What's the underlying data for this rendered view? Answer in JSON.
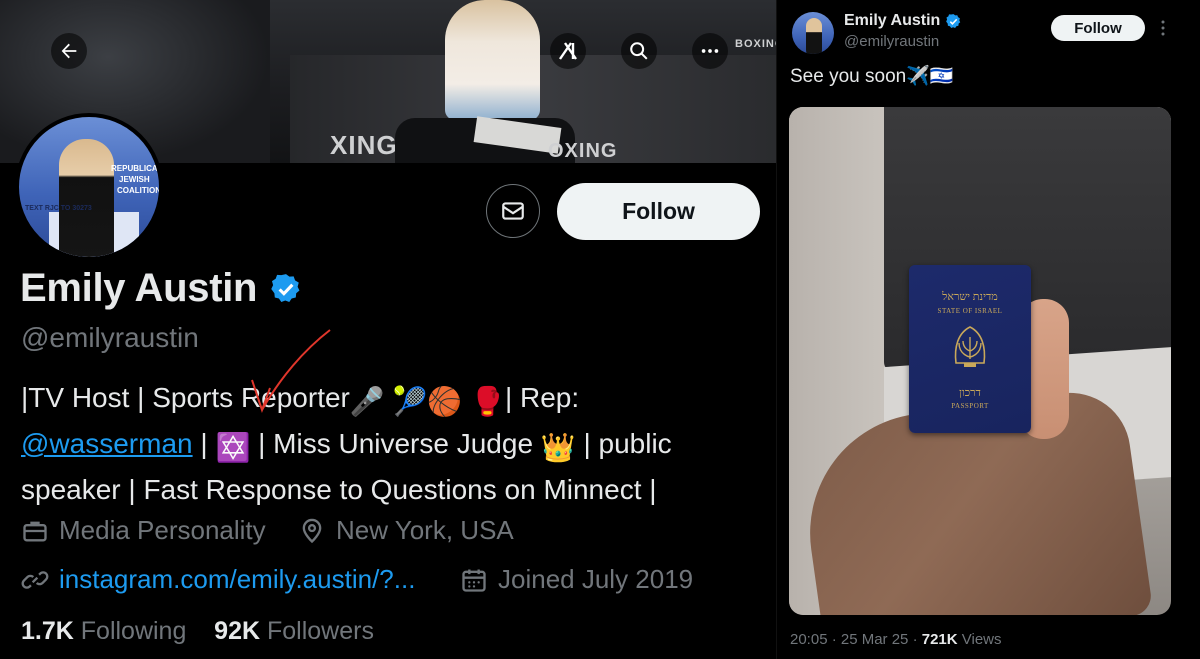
{
  "profile": {
    "banner": {
      "logo_texts": [
        "BOXING",
        "XING",
        "OXING"
      ],
      "back_icon": "arrow-left-icon",
      "grok_icon": "grok-icon",
      "search_icon": "search-icon",
      "more_icon": "more-horizontal-icon"
    },
    "avatar_texts": [
      "REPUBLICAN",
      "JEWISH",
      "COALITION",
      "TEXT RJC TO 30273"
    ],
    "follow_label": "Follow",
    "name": "Emily Austin",
    "handle": "@emilyraustin",
    "bio": {
      "line1_a": "|TV Host | Sports Reporter",
      "line1_b": "| Rep:",
      "mention": "@wasserman",
      "sep1": " | ",
      "line2_b": " | Miss Universe Judge ",
      "line2_c": " | public",
      "line3": "speaker | Fast Response to Questions on Minnect |",
      "emojis": [
        "🎤",
        "🎾",
        "🏀",
        "🥊",
        "✡️",
        "👑"
      ]
    },
    "category": "Media Personality",
    "location": "New York, USA",
    "website": "instagram.com/emily.austin/?...",
    "joined": "Joined July 2019",
    "following_count": "1.7K",
    "following_label": "Following",
    "followers_count": "92K",
    "followers_label": "Followers"
  },
  "tweet": {
    "name": "Emily Austin",
    "handle": "@emilyraustin",
    "follow_label": "Follow",
    "text": "See you soon",
    "text_emojis": "✈️🇮🇱",
    "passport": {
      "hebrew_top": "מדינת ישראל",
      "english_top": "STATE OF ISRAEL",
      "hebrew_bottom": "דרכון",
      "english_bottom": "PASSPORT"
    },
    "time": "20:05 · 25 Mar 25 · ",
    "views_count": "721K",
    "views_label": " Views"
  },
  "colors": {
    "background": "#000000",
    "text_primary": "#e7e9ea",
    "text_secondary": "#71767b",
    "link": "#1d9bf0",
    "verified": "#1d9bf0",
    "button_bg": "#eff3f4",
    "annotation": "#e0362b"
  }
}
